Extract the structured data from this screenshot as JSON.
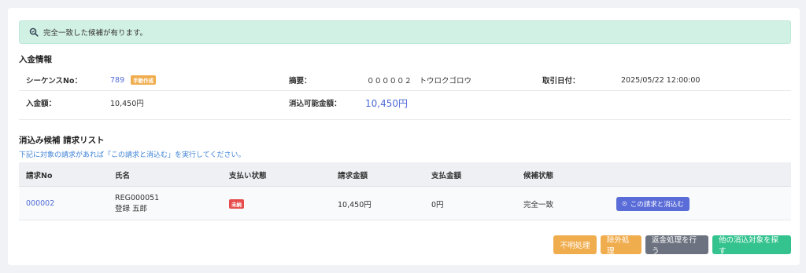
{
  "alert": {
    "text": "完全一致した候補が有ります。",
    "icon": "search-check-icon"
  },
  "deposit_info": {
    "title": "入金情報",
    "sequence_label": "シーケンスNo：",
    "sequence_value": "789",
    "sequence_badge": "手動作成",
    "summary_label": "摘要：",
    "summary_value": "０００００２　トウロクゴロウ",
    "trade_date_label": "取引日付：",
    "trade_date_value": "2025/05/22 12:00:00",
    "amount_label": "入金額：",
    "amount_value": "10,450円",
    "available_label": "消込可能金額：",
    "available_value": "10,450円"
  },
  "candidates": {
    "title": "消込み候補 請求リスト",
    "note": "下記に対象の請求があれば「この請求と消込む」を実行してください。",
    "headers": [
      "請求No",
      "氏名",
      "支払い状態",
      "請求金額",
      "支払金額",
      "候補状態"
    ],
    "rows": [
      {
        "invoice_no": "000002",
        "name_code": "REG000051",
        "name": "登録 五郎",
        "pay_status": "未納",
        "invoice_amount": "10,450円",
        "paid_amount": "0円",
        "candidate_status": "完全一致",
        "action_label": "この請求と消込む"
      }
    ]
  },
  "actions": {
    "unknown": "不明処理",
    "exclude": "除外処理",
    "refund": "返金処理を行う",
    "search_other": "他の消込対象を探す"
  },
  "colors": {
    "accent": "#4f6bd6",
    "success_bg": "#d2f1e5",
    "warning": "#f0ad4e",
    "danger": "#e74c4c",
    "secondary": "#6c727f",
    "green": "#34c38f"
  }
}
